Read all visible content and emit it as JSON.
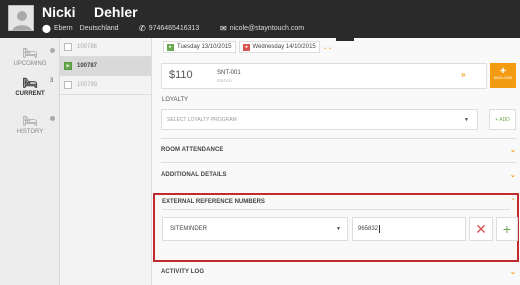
{
  "guest": {
    "first_name": "Nicki",
    "last_name": "Dehler",
    "city": "Ebern",
    "country": "Deutschland",
    "phone": "9746465416313",
    "email": "nicole@stayntouch.com"
  },
  "rail": {
    "items": [
      {
        "label": "UPCOMING"
      },
      {
        "label": "CURRENT",
        "count": "3"
      },
      {
        "label": "HISTORY"
      }
    ]
  },
  "reservations": [
    {
      "number": "100786"
    },
    {
      "number": "100787"
    },
    {
      "number": "100789"
    }
  ],
  "stay": {
    "arrival": "Tuesday 13/10/2015",
    "departure": "Wednesday 14/10/2015"
  },
  "rate": {
    "amount": "$110",
    "code": "SNT-001",
    "status": "EDITED",
    "addons_label": "ADD-ONS"
  },
  "loyalty": {
    "label": "LOYALTY",
    "placeholder": "SELECT LOYALTY PROGRAM",
    "add_label": "+ ADD"
  },
  "sections": {
    "room_attendance": "ROOM ATTENDANCE",
    "additional_details": "ADDITIONAL DETAILS",
    "external_refs": "EXTERNAL REFERENCE NUMBERS",
    "activity_log": "ACTIVITY LOG"
  },
  "external_ref": {
    "system": "SITEMINDER",
    "number": "965832"
  },
  "colors": {
    "accent": "#f39c12",
    "header": "#2a2a2a",
    "highlight_border": "#c12b2b",
    "add_green": "#6aa84f",
    "delete_red": "#d9534f"
  }
}
